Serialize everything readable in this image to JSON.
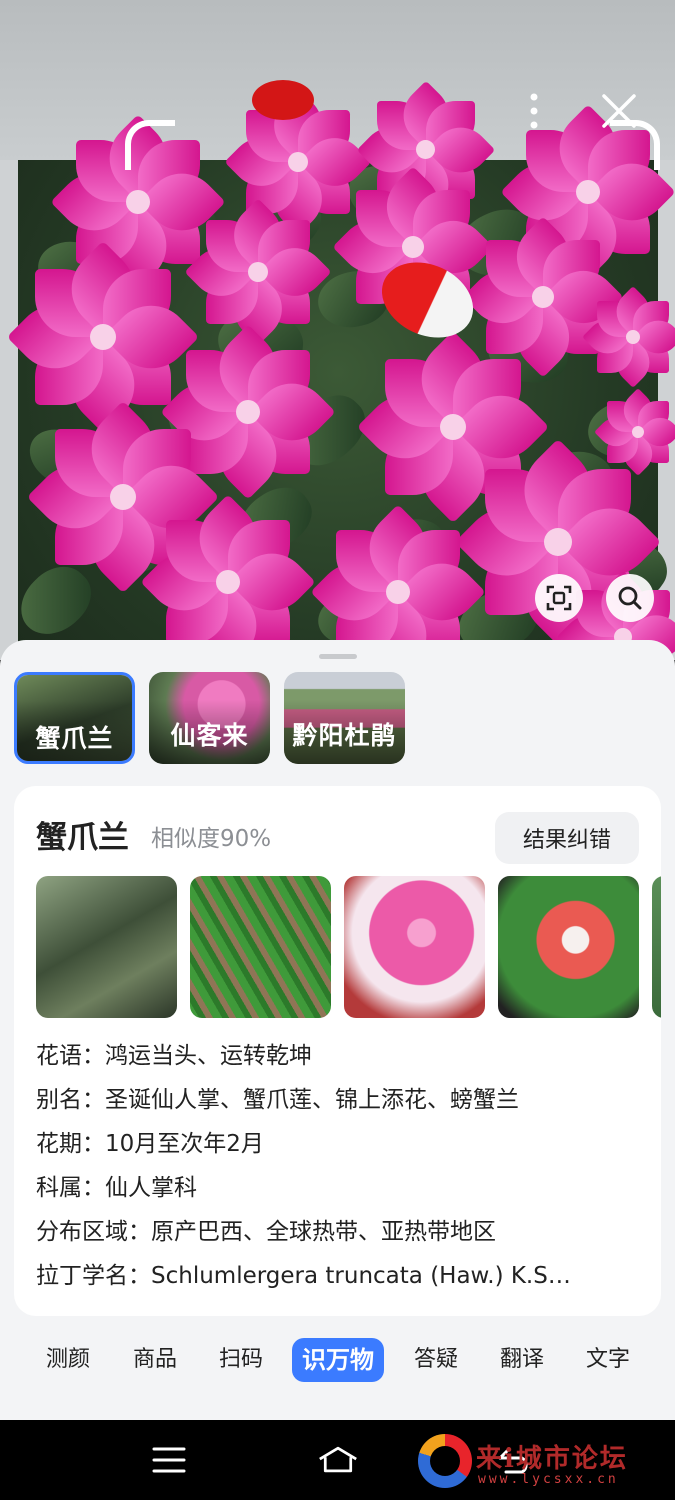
{
  "viewfinder": {
    "more_icon": "vertical-dots-icon",
    "close_icon": "close-icon",
    "crop_icon": "crop-scan-icon",
    "search_icon": "search-icon"
  },
  "candidates": [
    {
      "label": "蟹爪兰",
      "selected": true
    },
    {
      "label": "仙客来",
      "selected": false
    },
    {
      "label": "黔阳杜鹃",
      "selected": false
    }
  ],
  "result": {
    "name": "蟹爪兰",
    "similarity": "相似度90%",
    "correct_label": "结果纠错",
    "facts": [
      {
        "key": "花语：",
        "value": "鸿运当头、运转乾坤"
      },
      {
        "key": "别名：",
        "value": "圣诞仙人掌、蟹爪莲、锦上添花、螃蟹兰"
      },
      {
        "key": "花期：",
        "value": "10月至次年2月"
      },
      {
        "key": "科属：",
        "value": "仙人掌科"
      },
      {
        "key": "分布区域：",
        "value": "原产巴西、全球热带、亚热带地区"
      },
      {
        "key": "拉丁学名：",
        "value": "Schlumlergera truncata (Haw.) K.S…"
      }
    ]
  },
  "modes": [
    {
      "label": "测颜",
      "active": false
    },
    {
      "label": "商品",
      "active": false
    },
    {
      "label": "扫码",
      "active": false
    },
    {
      "label": "识万物",
      "active": true
    },
    {
      "label": "答疑",
      "active": false
    },
    {
      "label": "翻译",
      "active": false
    },
    {
      "label": "文字",
      "active": false
    }
  ],
  "navbar": {
    "menu_icon": "menu-icon",
    "home_icon": "home-icon",
    "back_icon": "back-icon"
  },
  "watermark": {
    "title": "来i城市论坛",
    "url": "www.lycsxx.cn"
  },
  "colors": {
    "accent": "#3b7bff",
    "sheet_bg": "#f3f4f6"
  }
}
